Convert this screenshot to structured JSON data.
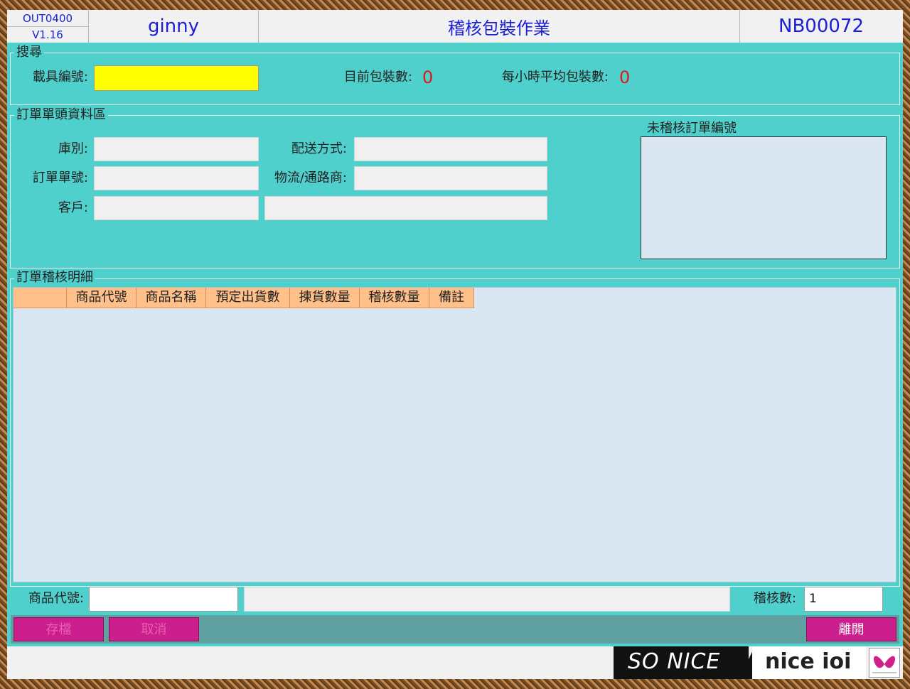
{
  "header": {
    "program_id": "OUT0400",
    "version": "V1.16",
    "user": "ginny",
    "title": "稽核包裝作業",
    "station": "NB00072"
  },
  "search": {
    "group_title": "搜尋",
    "carrier_label": "載具編號:",
    "carrier_value": "",
    "current_count_label": "目前包裝數:",
    "current_count": "0",
    "hourly_avg_label": "每小時平均包裝數:",
    "hourly_avg": "0"
  },
  "order_header": {
    "group_title": "訂單單頭資料區",
    "warehouse_label": "庫別:",
    "order_no_label": "訂單單號:",
    "customer_label": "客戶:",
    "delivery_label": "配送方式:",
    "logistics_label": "物流/通路商:",
    "pending_title": "未稽核訂單編號"
  },
  "detail": {
    "group_title": "訂單稽核明細",
    "columns": [
      "",
      "商品代號",
      "商品名稱",
      "預定出貨數",
      "揀貨數量",
      "稽核數量",
      "備註"
    ]
  },
  "entry": {
    "product_code_label": "商品代號:",
    "audit_qty_label": "稽核數:",
    "audit_qty_value": "1"
  },
  "buttons": {
    "save": "存檔",
    "cancel": "取消",
    "exit": "離開"
  },
  "logos": {
    "so_nice": "SO NICE",
    "nice_ioi": "nice ioi"
  }
}
